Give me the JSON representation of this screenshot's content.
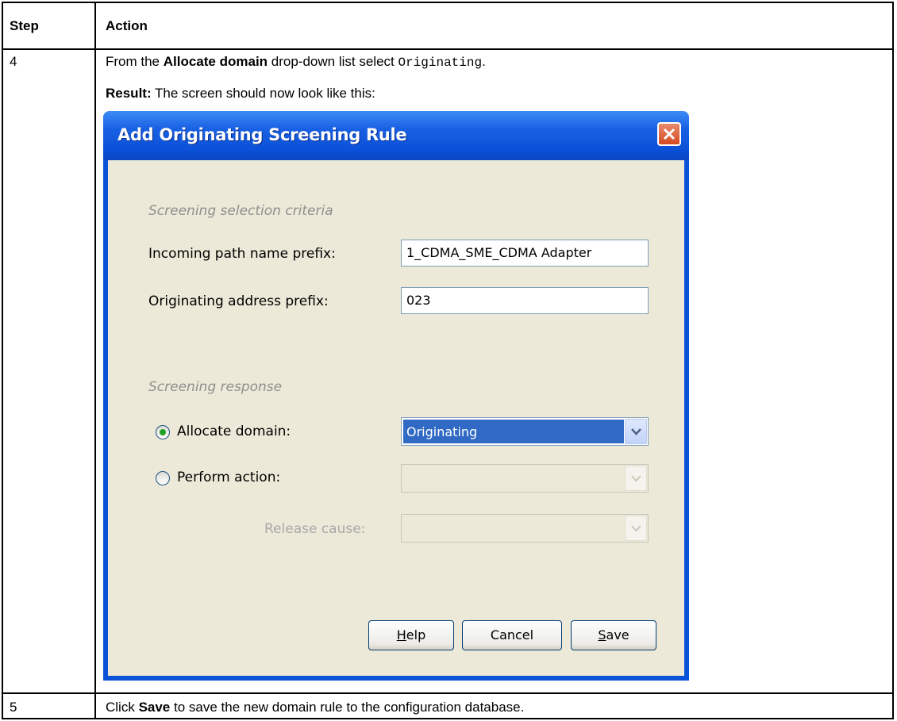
{
  "table": {
    "header_step": "Step",
    "header_action": "Action",
    "row4": {
      "step": "4",
      "line1_pre": "From the ",
      "line1_bold": "Allocate domain",
      "line1_mid": " drop-down list select ",
      "line1_code": "Originating",
      "line1_post": ".",
      "line2_bold": "Result:",
      "line2_rest": " The screen should now look like this:"
    },
    "row5": {
      "step": "5",
      "pre": "Click ",
      "bold": "Save",
      "post": " to save the new domain rule to the configuration database."
    }
  },
  "dialog": {
    "title": "Add Originating Screening Rule",
    "criteria_heading": "Screening selection criteria",
    "incoming_label": "Incoming path name prefix:",
    "incoming_value": "1_CDMA_SME_CDMA Adapter",
    "orig_label": "Originating address prefix:",
    "orig_value": "023",
    "response_heading": "Screening response",
    "allocate_label": "Allocate domain:",
    "allocate_value": "Originating",
    "perform_label": "Perform action:",
    "release_label": "Release cause:",
    "help_pre": "",
    "help_u": "H",
    "help_post": "elp",
    "cancel_label": "Cancel",
    "save_u": "S",
    "save_post": "ave",
    "colors": {
      "titlebar": "#0a53d8",
      "client": "#ece9d8",
      "selection": "#316ac5",
      "close": "#d34a1f"
    },
    "icons": [
      "close-icon",
      "chevron-down-icon"
    ]
  }
}
